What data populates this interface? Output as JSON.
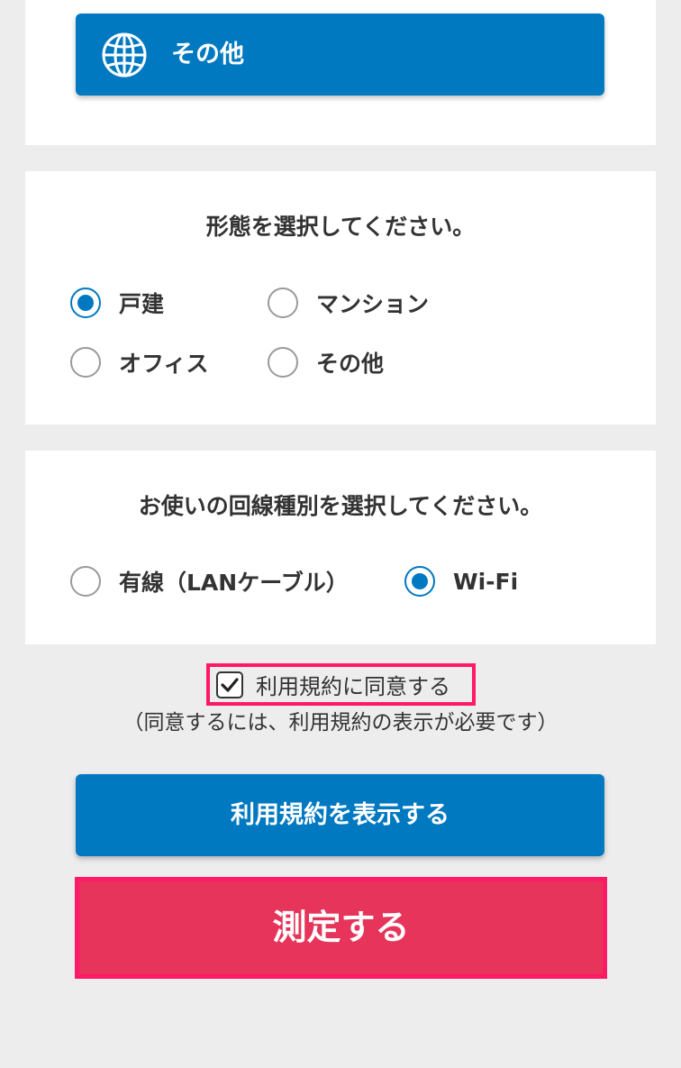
{
  "top_section": {
    "other_button_label": "その他"
  },
  "type_section": {
    "title": "形態を選択してください。",
    "options": [
      {
        "label": "戸建",
        "selected": true
      },
      {
        "label": "マンション",
        "selected": false
      },
      {
        "label": "オフィス",
        "selected": false
      },
      {
        "label": "その他",
        "selected": false
      }
    ]
  },
  "line_section": {
    "title": "お使いの回線種別を選択してください。",
    "options": [
      {
        "label": "有線（LANケーブル）",
        "selected": false
      },
      {
        "label": "Wi-Fi",
        "selected": true
      }
    ]
  },
  "agreement": {
    "checkbox_label": "利用規約に同意する",
    "checked": true,
    "note": "（同意するには、利用規約の表示が必要です）"
  },
  "buttons": {
    "show_terms": "利用規約を表示する",
    "measure": "測定する"
  },
  "colors": {
    "primary_blue": "#0079c1",
    "measure_red": "#e6345a",
    "highlight_pink": "#ff1966",
    "background": "#ededed"
  }
}
